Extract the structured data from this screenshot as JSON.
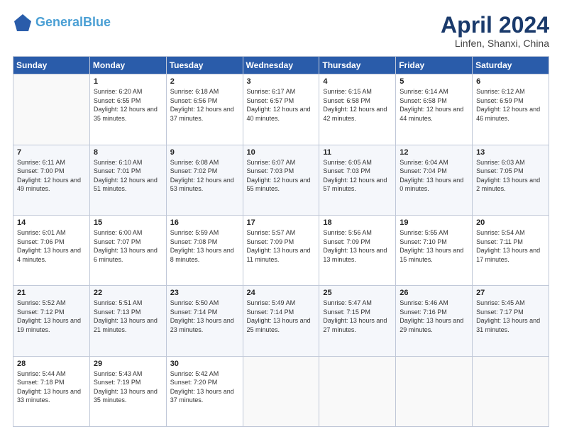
{
  "header": {
    "logo_line1": "General",
    "logo_line2": "Blue",
    "title": "April 2024",
    "subtitle": "Linfen, Shanxi, China"
  },
  "columns": [
    "Sunday",
    "Monday",
    "Tuesday",
    "Wednesday",
    "Thursday",
    "Friday",
    "Saturday"
  ],
  "weeks": [
    [
      {
        "day": "",
        "sunrise": "",
        "sunset": "",
        "daylight": ""
      },
      {
        "day": "1",
        "sunrise": "Sunrise: 6:20 AM",
        "sunset": "Sunset: 6:55 PM",
        "daylight": "Daylight: 12 hours and 35 minutes."
      },
      {
        "day": "2",
        "sunrise": "Sunrise: 6:18 AM",
        "sunset": "Sunset: 6:56 PM",
        "daylight": "Daylight: 12 hours and 37 minutes."
      },
      {
        "day": "3",
        "sunrise": "Sunrise: 6:17 AM",
        "sunset": "Sunset: 6:57 PM",
        "daylight": "Daylight: 12 hours and 40 minutes."
      },
      {
        "day": "4",
        "sunrise": "Sunrise: 6:15 AM",
        "sunset": "Sunset: 6:58 PM",
        "daylight": "Daylight: 12 hours and 42 minutes."
      },
      {
        "day": "5",
        "sunrise": "Sunrise: 6:14 AM",
        "sunset": "Sunset: 6:58 PM",
        "daylight": "Daylight: 12 hours and 44 minutes."
      },
      {
        "day": "6",
        "sunrise": "Sunrise: 6:12 AM",
        "sunset": "Sunset: 6:59 PM",
        "daylight": "Daylight: 12 hours and 46 minutes."
      }
    ],
    [
      {
        "day": "7",
        "sunrise": "Sunrise: 6:11 AM",
        "sunset": "Sunset: 7:00 PM",
        "daylight": "Daylight: 12 hours and 49 minutes."
      },
      {
        "day": "8",
        "sunrise": "Sunrise: 6:10 AM",
        "sunset": "Sunset: 7:01 PM",
        "daylight": "Daylight: 12 hours and 51 minutes."
      },
      {
        "day": "9",
        "sunrise": "Sunrise: 6:08 AM",
        "sunset": "Sunset: 7:02 PM",
        "daylight": "Daylight: 12 hours and 53 minutes."
      },
      {
        "day": "10",
        "sunrise": "Sunrise: 6:07 AM",
        "sunset": "Sunset: 7:03 PM",
        "daylight": "Daylight: 12 hours and 55 minutes."
      },
      {
        "day": "11",
        "sunrise": "Sunrise: 6:05 AM",
        "sunset": "Sunset: 7:03 PM",
        "daylight": "Daylight: 12 hours and 57 minutes."
      },
      {
        "day": "12",
        "sunrise": "Sunrise: 6:04 AM",
        "sunset": "Sunset: 7:04 PM",
        "daylight": "Daylight: 13 hours and 0 minutes."
      },
      {
        "day": "13",
        "sunrise": "Sunrise: 6:03 AM",
        "sunset": "Sunset: 7:05 PM",
        "daylight": "Daylight: 13 hours and 2 minutes."
      }
    ],
    [
      {
        "day": "14",
        "sunrise": "Sunrise: 6:01 AM",
        "sunset": "Sunset: 7:06 PM",
        "daylight": "Daylight: 13 hours and 4 minutes."
      },
      {
        "day": "15",
        "sunrise": "Sunrise: 6:00 AM",
        "sunset": "Sunset: 7:07 PM",
        "daylight": "Daylight: 13 hours and 6 minutes."
      },
      {
        "day": "16",
        "sunrise": "Sunrise: 5:59 AM",
        "sunset": "Sunset: 7:08 PM",
        "daylight": "Daylight: 13 hours and 8 minutes."
      },
      {
        "day": "17",
        "sunrise": "Sunrise: 5:57 AM",
        "sunset": "Sunset: 7:09 PM",
        "daylight": "Daylight: 13 hours and 11 minutes."
      },
      {
        "day": "18",
        "sunrise": "Sunrise: 5:56 AM",
        "sunset": "Sunset: 7:09 PM",
        "daylight": "Daylight: 13 hours and 13 minutes."
      },
      {
        "day": "19",
        "sunrise": "Sunrise: 5:55 AM",
        "sunset": "Sunset: 7:10 PM",
        "daylight": "Daylight: 13 hours and 15 minutes."
      },
      {
        "day": "20",
        "sunrise": "Sunrise: 5:54 AM",
        "sunset": "Sunset: 7:11 PM",
        "daylight": "Daylight: 13 hours and 17 minutes."
      }
    ],
    [
      {
        "day": "21",
        "sunrise": "Sunrise: 5:52 AM",
        "sunset": "Sunset: 7:12 PM",
        "daylight": "Daylight: 13 hours and 19 minutes."
      },
      {
        "day": "22",
        "sunrise": "Sunrise: 5:51 AM",
        "sunset": "Sunset: 7:13 PM",
        "daylight": "Daylight: 13 hours and 21 minutes."
      },
      {
        "day": "23",
        "sunrise": "Sunrise: 5:50 AM",
        "sunset": "Sunset: 7:14 PM",
        "daylight": "Daylight: 13 hours and 23 minutes."
      },
      {
        "day": "24",
        "sunrise": "Sunrise: 5:49 AM",
        "sunset": "Sunset: 7:14 PM",
        "daylight": "Daylight: 13 hours and 25 minutes."
      },
      {
        "day": "25",
        "sunrise": "Sunrise: 5:47 AM",
        "sunset": "Sunset: 7:15 PM",
        "daylight": "Daylight: 13 hours and 27 minutes."
      },
      {
        "day": "26",
        "sunrise": "Sunrise: 5:46 AM",
        "sunset": "Sunset: 7:16 PM",
        "daylight": "Daylight: 13 hours and 29 minutes."
      },
      {
        "day": "27",
        "sunrise": "Sunrise: 5:45 AM",
        "sunset": "Sunset: 7:17 PM",
        "daylight": "Daylight: 13 hours and 31 minutes."
      }
    ],
    [
      {
        "day": "28",
        "sunrise": "Sunrise: 5:44 AM",
        "sunset": "Sunset: 7:18 PM",
        "daylight": "Daylight: 13 hours and 33 minutes."
      },
      {
        "day": "29",
        "sunrise": "Sunrise: 5:43 AM",
        "sunset": "Sunset: 7:19 PM",
        "daylight": "Daylight: 13 hours and 35 minutes."
      },
      {
        "day": "30",
        "sunrise": "Sunrise: 5:42 AM",
        "sunset": "Sunset: 7:20 PM",
        "daylight": "Daylight: 13 hours and 37 minutes."
      },
      {
        "day": "",
        "sunrise": "",
        "sunset": "",
        "daylight": ""
      },
      {
        "day": "",
        "sunrise": "",
        "sunset": "",
        "daylight": ""
      },
      {
        "day": "",
        "sunrise": "",
        "sunset": "",
        "daylight": ""
      },
      {
        "day": "",
        "sunrise": "",
        "sunset": "",
        "daylight": ""
      }
    ]
  ]
}
